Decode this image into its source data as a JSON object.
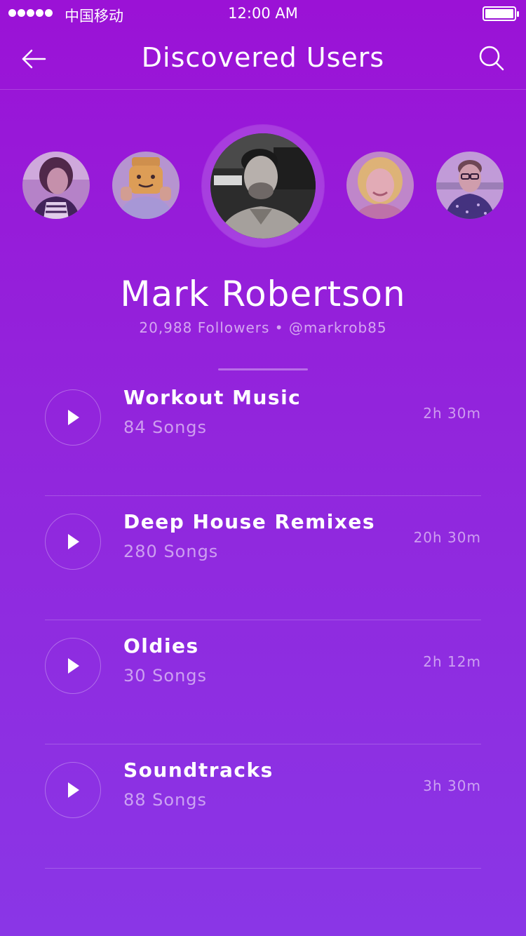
{
  "status_bar": {
    "carrier": "中国移动",
    "time": "12:00 AM"
  },
  "nav": {
    "title": "Discovered Users",
    "back_icon": "arrow-left-icon",
    "search_icon": "search-icon"
  },
  "profile": {
    "name": "Mark Robertson",
    "meta": "20,988 Followers • @markrob85"
  },
  "playlists": [
    {
      "title": "Workout Music",
      "count": "84 Songs",
      "duration": "2h 30m"
    },
    {
      "title": "Deep House Remixes",
      "count": "280 Songs",
      "duration": "20h 30m"
    },
    {
      "title": "Oldies",
      "count": "30 Songs",
      "duration": "2h 12m"
    },
    {
      "title": "Soundtracks",
      "count": "88 Songs",
      "duration": "3h 30m"
    }
  ],
  "colors": {
    "background_top": "#9b12d6",
    "background_bottom": "#8a36e6",
    "text": "#ffffff"
  }
}
